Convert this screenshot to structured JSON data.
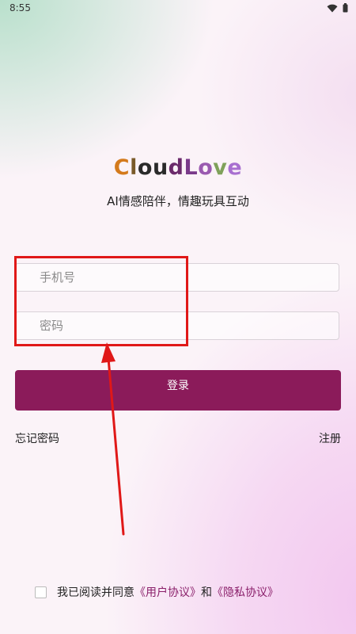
{
  "status_bar": {
    "time": "8:55",
    "icons": [
      "wifi-icon",
      "battery-icon"
    ]
  },
  "brand": {
    "app_name_letters": [
      "C",
      "l",
      "o",
      "u",
      "d",
      "L",
      "o",
      "v",
      "e"
    ],
    "tagline": "AI情感陪伴，情趣玩具互动"
  },
  "form": {
    "phone_placeholder": "手机号",
    "password_placeholder": "密码",
    "login_label": "登录"
  },
  "links": {
    "forgot_password": "忘记密码",
    "register": "注册"
  },
  "agreement": {
    "text_prefix": "我已阅读并同意",
    "user_agreement": "《用户协议》",
    "conjunction": "和",
    "privacy_policy": "《隐私协议》",
    "checked": false
  },
  "colors": {
    "primary": "#8b1b5a",
    "link_purple": "#8a1f6a",
    "annotation_red": "#e01818"
  }
}
